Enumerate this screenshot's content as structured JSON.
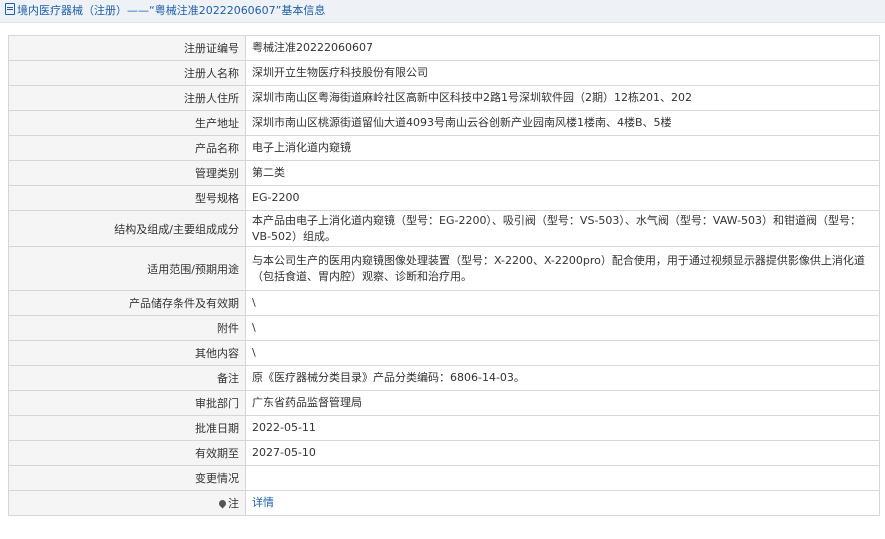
{
  "header": {
    "title": "境内医疗器械（注册）——“粤械注准20222060607”基本信息"
  },
  "rows": [
    {
      "label": "注册证编号",
      "value": "粤械注准20222060607"
    },
    {
      "label": "注册人名称",
      "value": "深圳开立生物医疗科技股份有限公司"
    },
    {
      "label": "注册人住所",
      "value": "深圳市南山区粤海街道麻岭社区高新中区科技中2路1号深圳软件园（2期）12栋201、202"
    },
    {
      "label": "生产地址",
      "value": "深圳市南山区桃源街道留仙大道4093号南山云谷创新产业园南风楼1楼南、4楼B、5楼"
    },
    {
      "label": "产品名称",
      "value": "电子上消化道内窥镜"
    },
    {
      "label": "管理类别",
      "value": "第二类"
    },
    {
      "label": "型号规格",
      "value": "EG-2200"
    },
    {
      "label": "结构及组成/主要组成成分",
      "value": "本产品由电子上消化道内窥镜（型号：EG-2200）、吸引阀（型号：VS-503）、水气阀（型号：VAW-503）和钳道阀（型号：VB-502）组成。"
    },
    {
      "label": "适用范围/预期用途",
      "value": "与本公司生产的医用内窥镜图像处理装置（型号：X-2200、X-2200pro）配合使用，用于通过视频显示器提供影像供上消化道（包括食道、胃内腔）观察、诊断和治疗用。"
    },
    {
      "label": "产品储存条件及有效期",
      "value": "\\"
    },
    {
      "label": "附件",
      "value": "\\"
    },
    {
      "label": "其他内容",
      "value": "\\"
    },
    {
      "label": "备注",
      "value": "原《医疗器械分类目录》产品分类编码：6806-14-03。"
    },
    {
      "label": "审批部门",
      "value": "广东省药品监督管理局"
    },
    {
      "label": "批准日期",
      "value": "2022-05-11"
    },
    {
      "label": "有效期至",
      "value": "2027-05-10"
    },
    {
      "label": "变更情况",
      "value": ""
    }
  ],
  "note": {
    "label": "注",
    "icon": "pin-icon",
    "link_text": "详情"
  },
  "colors": {
    "link": "#1d5fa8",
    "label_bg": "#f5f5f5",
    "border": "#d6d6d6"
  }
}
